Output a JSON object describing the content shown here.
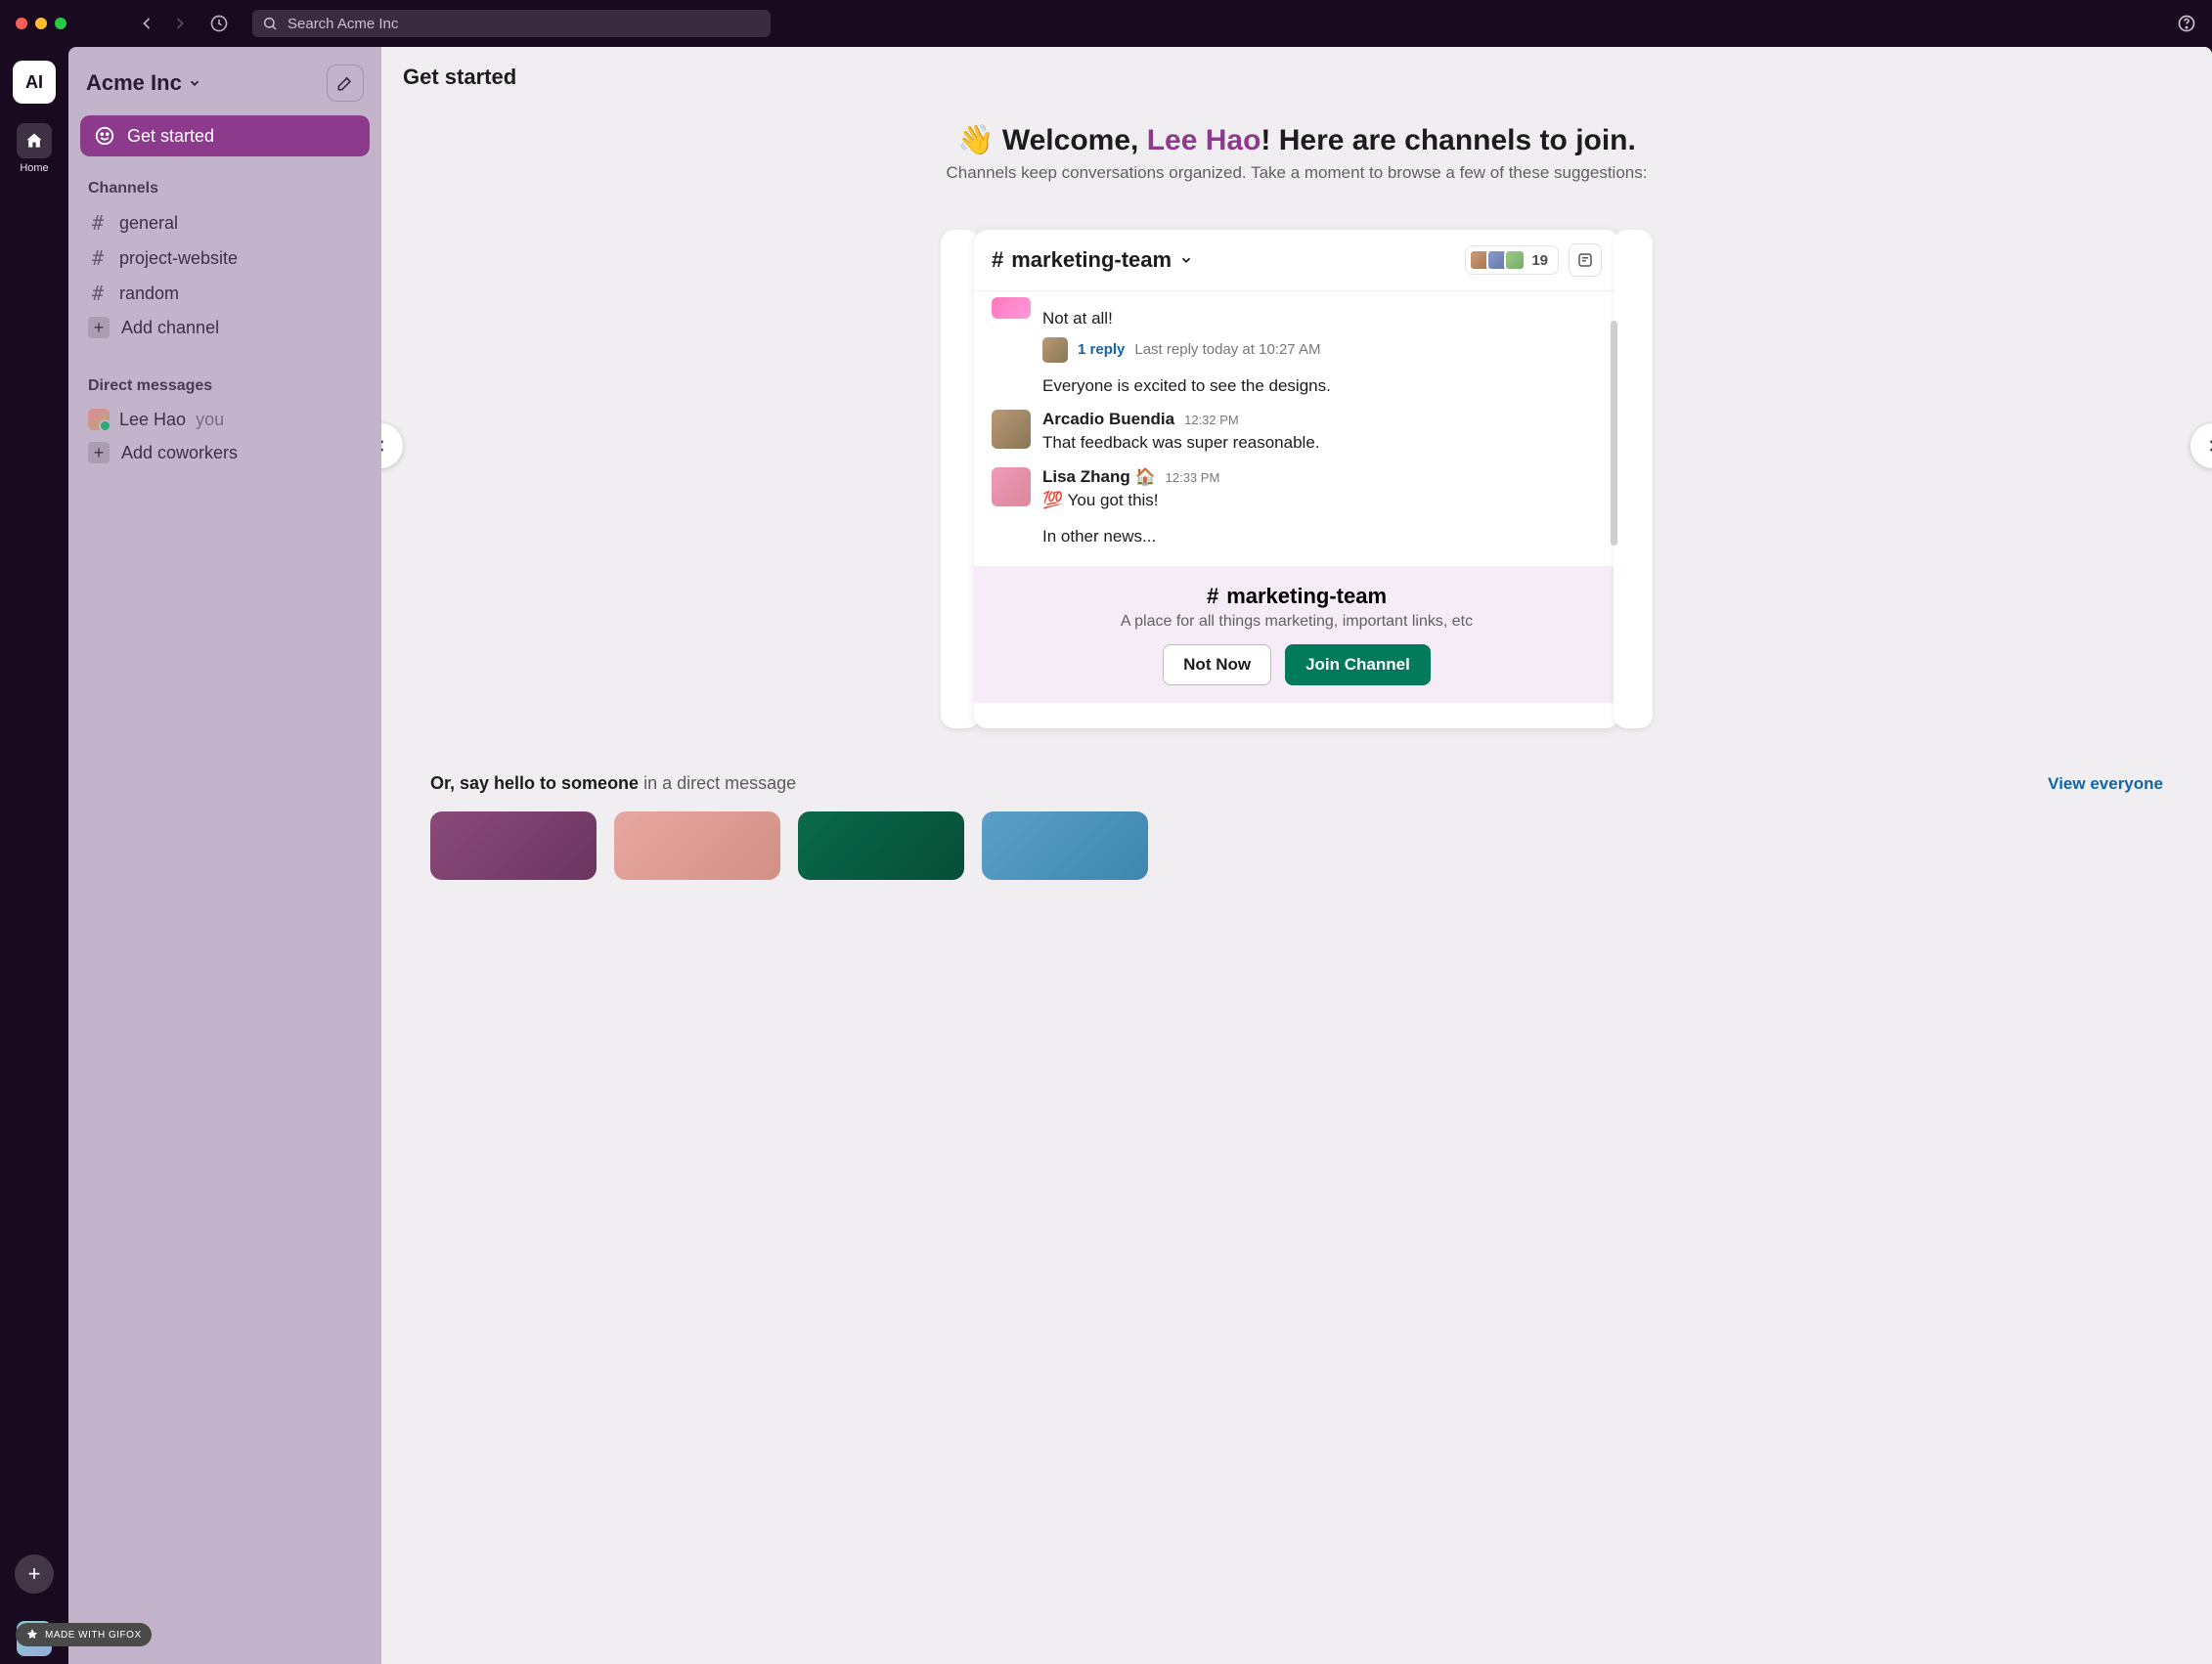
{
  "search": {
    "placeholder": "Search Acme Inc"
  },
  "rail": {
    "workspace_abbrev": "AI",
    "home_label": "Home"
  },
  "sidebar": {
    "workspace": "Acme Inc",
    "get_started": "Get started",
    "channels_header": "Channels",
    "channels": [
      "general",
      "project-website",
      "random"
    ],
    "add_channel": "Add channel",
    "dm_header": "Direct messages",
    "self_name": "Lee Hao",
    "you_label": "you",
    "add_coworkers": "Add coworkers"
  },
  "main": {
    "header": "Get started",
    "welcome_pre": "Welcome, ",
    "welcome_name": "Lee Hao",
    "welcome_post": "! Here are channels to join.",
    "welcome_sub": "Channels keep conversations organized. Take a moment to browse a few of these suggestions:"
  },
  "card": {
    "channel": "marketing-team",
    "member_count": "19",
    "msg0_text": "Not at all!",
    "reply_count": "1 reply",
    "reply_time": "Last reply today at 10:27 AM",
    "msg0_extra": "Everyone is excited to see the designs.",
    "msg1_name": "Arcadio Buendia",
    "msg1_time": "12:32 PM",
    "msg1_text": "That feedback was super reasonable.",
    "msg2_name": "Lisa Zhang 🏠",
    "msg2_time": "12:33 PM",
    "msg2_text": "💯 You got this!",
    "msg2_extra": "In other news...",
    "join_channel": "marketing-team",
    "join_desc": "A place for all things marketing, important links, etc",
    "btn_notnow": "Not Now",
    "btn_join": "Join Channel"
  },
  "dm": {
    "prompt_bold": "Or, say hello to someone",
    "prompt_rest": " in a direct message",
    "view_all": "View everyone"
  },
  "gifox": "MADE WITH GIFOX"
}
